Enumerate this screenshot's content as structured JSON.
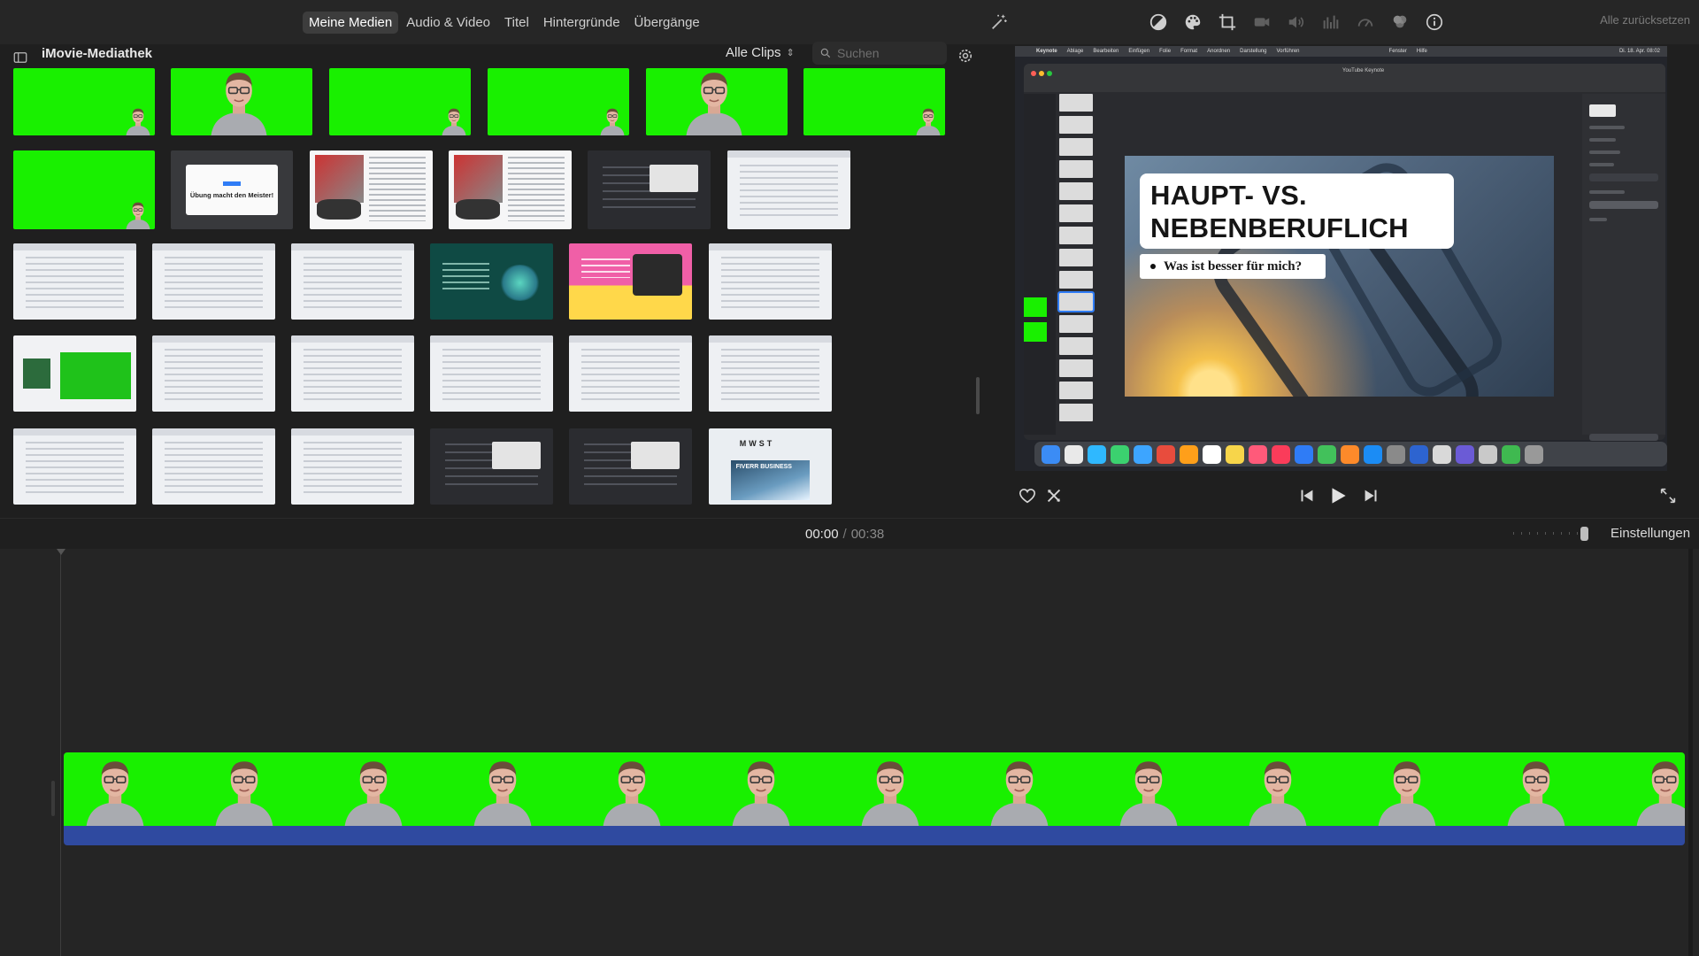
{
  "app": "iMovie",
  "topbar": {
    "tabs": [
      {
        "label": "Meine Medien",
        "active": true
      },
      {
        "label": "Audio & Video",
        "active": false
      },
      {
        "label": "Titel",
        "active": false
      },
      {
        "label": "Hintergründe",
        "active": false
      },
      {
        "label": "Übergänge",
        "active": false
      }
    ],
    "tools": [
      "magic-wand-icon",
      "color-balance-icon",
      "color-palette-icon",
      "crop-icon",
      "camera-stabilization-icon",
      "volume-icon",
      "equalizer-icon",
      "speed-icon",
      "clip-filter-icon",
      "info-icon"
    ],
    "reset_label": "Alle zurücksetzen"
  },
  "library": {
    "title": "iMovie-Mediathek",
    "filter_label": "Alle Clips",
    "search_placeholder": "Suchen",
    "thumbs": [
      {
        "kind": "gs",
        "person": "small"
      },
      {
        "kind": "gs",
        "person": "large"
      },
      {
        "kind": "gs",
        "person": "small"
      },
      {
        "kind": "gs",
        "person": "small"
      },
      {
        "kind": "gs",
        "person": "large"
      },
      {
        "kind": "gs",
        "person": "small"
      },
      {
        "kind": "gs",
        "person": "small"
      },
      {
        "kind": "slide",
        "text": "Übung macht den Meister!"
      },
      {
        "kind": "ad"
      },
      {
        "kind": "ad"
      },
      {
        "kind": "dark"
      },
      {
        "kind": "doc"
      },
      {
        "kind": "doc"
      },
      {
        "kind": "doc"
      },
      {
        "kind": "doc"
      },
      {
        "kind": "teal"
      },
      {
        "kind": "pink"
      },
      {
        "kind": "doc"
      },
      {
        "kind": "mixed"
      },
      {
        "kind": "doc"
      },
      {
        "kind": "doc"
      },
      {
        "kind": "doc"
      },
      {
        "kind": "doc"
      },
      {
        "kind": "doc"
      },
      {
        "kind": "doc"
      },
      {
        "kind": "doc"
      },
      {
        "kind": "doc"
      },
      {
        "kind": "dark"
      },
      {
        "kind": "dark"
      },
      {
        "kind": "fiverr",
        "text": "FIVERR BUSINESS",
        "head": "MWST"
      }
    ]
  },
  "viewer": {
    "slide_title_line1": "HAUPT- VS.",
    "slide_title_line2": "NEBENBERUFLICH",
    "slide_subtitle": "Was ist besser für mich?",
    "window_title": "YouTube Keynote",
    "menubar": [
      "Keynote",
      "Ablage",
      "Bearbeiten",
      "Einfügen",
      "Folie",
      "Format",
      "Anordnen",
      "Darstellung",
      "Vorführen",
      "Fenster",
      "Hilfe"
    ],
    "menubar_date": "Di. 18. Apr. 08:02",
    "controls": [
      "favorite-heart-icon",
      "reject-icon",
      "skip-back-icon",
      "play-icon",
      "skip-forward-icon",
      "fullscreen-icon"
    ]
  },
  "timeline": {
    "current_time": "00:00",
    "separator": "/",
    "total_time": "00:38",
    "settings_label": "Einstellungen"
  },
  "colors": {
    "greenscreen": "#19f000",
    "audio": "#2f4aa0",
    "background": "#1e1e1e"
  }
}
